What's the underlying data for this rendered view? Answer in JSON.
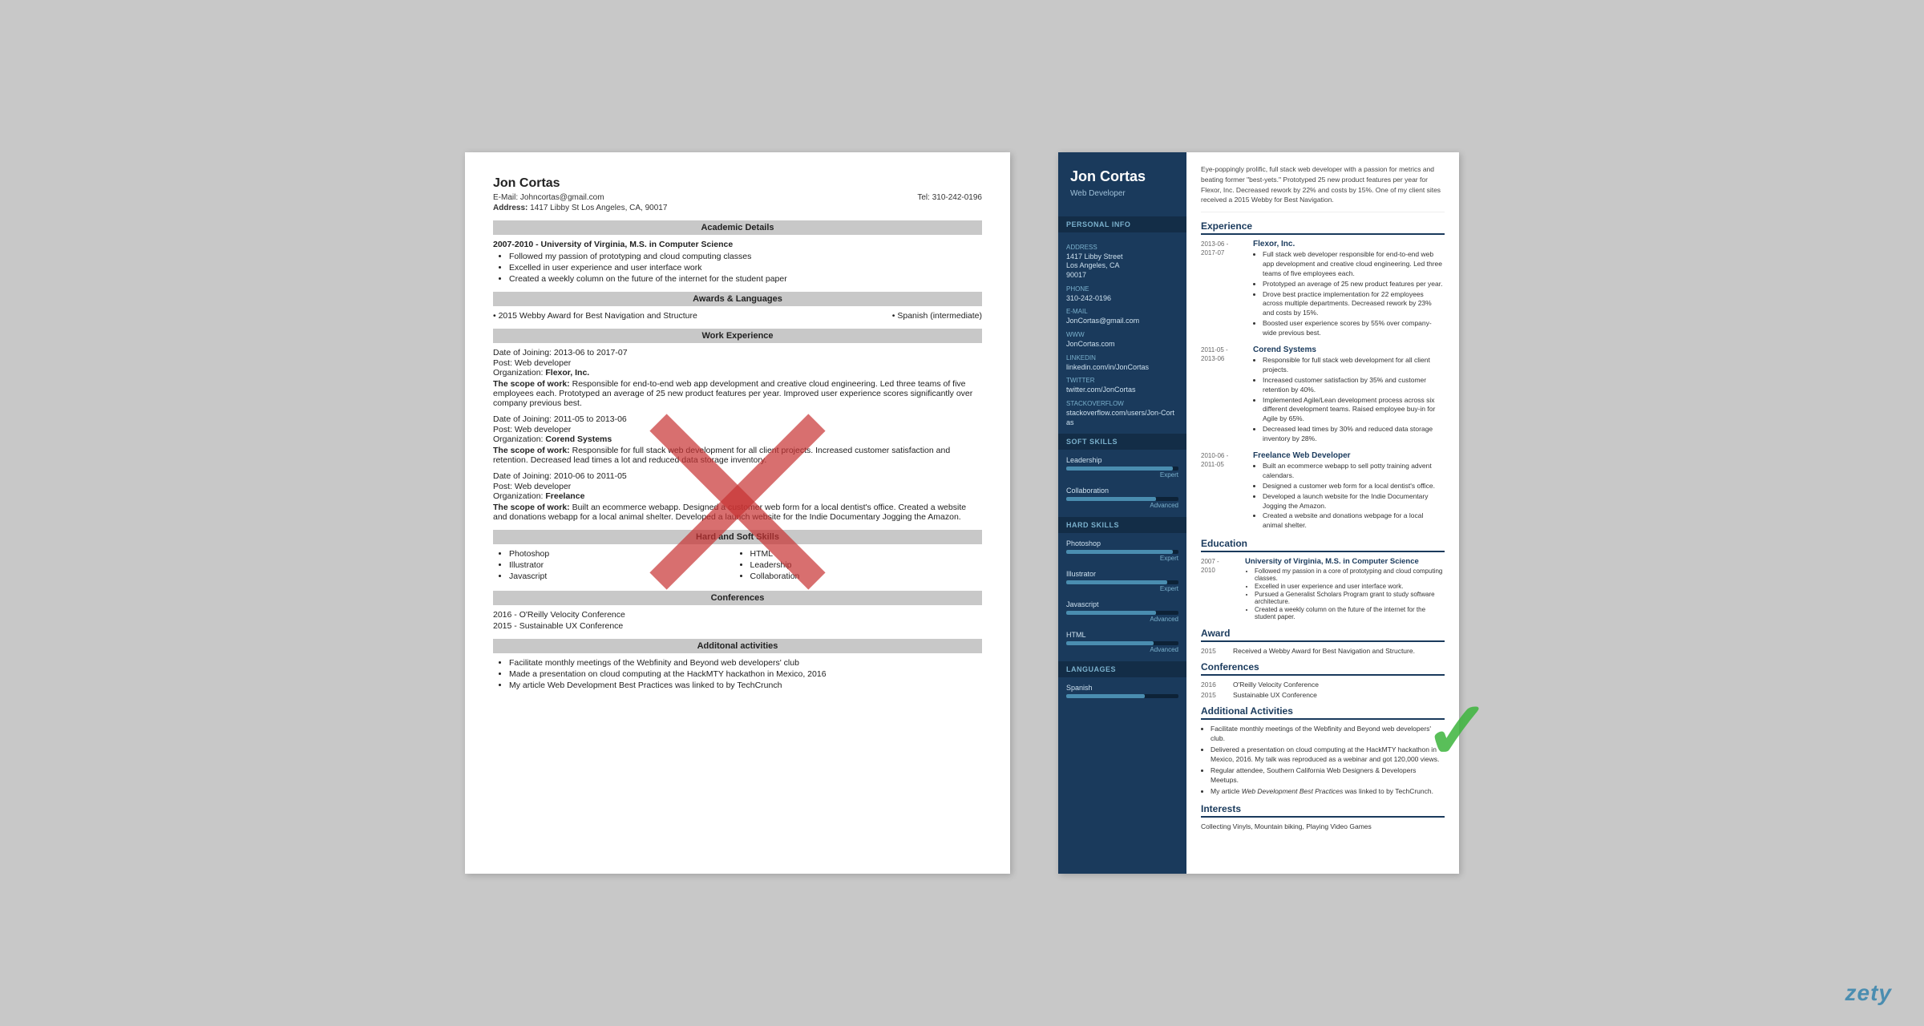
{
  "left_resume": {
    "name": "Jon Cortas",
    "email": "E-Mail: Johncortas@gmail.com",
    "tel": "Tel: 310-242-0196",
    "address_label": "Address:",
    "address": "1417 Libby St Los Angeles, CA, 90017",
    "sections": {
      "academic": "Academic Details",
      "awards": "Awards & Languages",
      "work": "Work Experience",
      "skills": "Hard and Soft Skills",
      "conferences": "Conferences",
      "activities": "Additonal activities"
    },
    "academic_items": [
      "2007-2010 - University of Virginia, M.S. in Computer Science",
      "Followed my passion of prototyping and cloud computing classes",
      "Excelled in user experience and user interface work",
      "Created a weekly column on the future of the internet for the student paper"
    ],
    "awards_items": [
      "2015 Webby Award for Best Navigation and Structure",
      "Spanish (intermediate)"
    ],
    "work_entries": [
      {
        "date": "Date of Joining: 2013-06 to 2017-07",
        "post": "Post: Web developer",
        "org": "Organization: Flexor, Inc.",
        "scope": "The scope of work: Responsible for end-to-end web app development and creative cloud engineering. Led three teams of five employees each. Prototyped an average of 25 new product features per year. Improved user experience scores significantly over company previous best."
      },
      {
        "date": "Date of Joining: 2011-05 to 2013-06",
        "post": "Post: Web developer",
        "org": "Organization: Corend Systems",
        "scope": "The scope of work: Responsible for full stack web development for all client projects. Increased customer satisfaction and retention. Decreased lead times a lot and reduced data storage inventory."
      },
      {
        "date": "Date of Joining: 2010-06 to 2011-05",
        "post": "Post: Web developer",
        "org": "Organization: Freelance",
        "scope": "The scope of work: Built an ecommerce webapp. Designed a customer web form for a local dentist's office. Created a website and donations webapp for a local animal shelter. Developed a launch website for the Indie Documentary Jogging the Amazon."
      }
    ],
    "skills_items": [
      "Photoshop",
      "Illustrator",
      "Javascript",
      "HTML",
      "Leadership",
      "Collaboration"
    ],
    "conferences_items": [
      "2016 - O'Reilly Velocity Conference",
      "2015 - Sustainable UX Conference"
    ],
    "activities_items": [
      "Facilitate monthly meetings of the Webfinity and Beyond web developers' club",
      "Made a presentation on cloud computing at the HackMTY hackathon in Mexico, 2016",
      "My article Web Development Best Practices was linked to by TechCrunch"
    ]
  },
  "right_resume": {
    "name": "Jon Cortas",
    "title": "Web Developer",
    "summary": "Eye-poppingly prolific, full stack web developer with a passion for metrics and beating former \"best-yets.\" Prototyped 25 new product features per year for Flexor, Inc. Decreased rework by 22% and costs by 15%. One of my client sites received a 2015 Webby for Best Navigation.",
    "sidebar": {
      "personal_info_title": "Personal Info",
      "address_label": "Address",
      "address_value": "1417 Libby Street\nLos Angeles, CA\n90017",
      "phone_label": "Phone",
      "phone_value": "310-242-0196",
      "email_label": "E-mail",
      "email_value": "JonCortas@gmail.com",
      "www_label": "WWW",
      "www_value": "JonCortas.com",
      "linkedin_label": "LinkedIn",
      "linkedin_value": "linkedin.com/in/JonCortas",
      "twitter_label": "Twitter",
      "twitter_value": "twitter.com/JonCortas",
      "stackoverflow_label": "StackOverflow",
      "stackoverflow_value": "stackoverflow.com/users/Jon-Cortas",
      "soft_skills_title": "Soft Skills",
      "soft_skills": [
        {
          "name": "Leadership",
          "level": 95,
          "label": "Expert"
        },
        {
          "name": "Collaboration",
          "level": 80,
          "label": "Advanced"
        }
      ],
      "hard_skills_title": "Hard Skills",
      "hard_skills": [
        {
          "name": "Photoshop",
          "level": 95,
          "label": "Expert"
        },
        {
          "name": "Illustrator",
          "level": 90,
          "label": "Expert"
        },
        {
          "name": "Javascript",
          "level": 80,
          "label": "Advanced"
        },
        {
          "name": "HTML",
          "level": 78,
          "label": "Advanced"
        }
      ],
      "languages_title": "Languages",
      "languages": [
        {
          "name": "Spanish",
          "level": 70
        }
      ]
    },
    "experience_title": "Experience",
    "experiences": [
      {
        "date": "2013-06 -\n2017-07",
        "company": "Flexor, Inc.",
        "bullets": [
          "Full stack web developer responsible for end-to-end web app development and creative cloud engineering. Led three teams of five employees each.",
          "Prototyped an average of 25 new product features per year.",
          "Drove best practice implementation for 22 employees across multiple departments. Decreased rework by 23% and costs by 15%.",
          "Boosted user experience scores by 55% over company-wide previous best."
        ]
      },
      {
        "date": "2011-05 -\n2013-06",
        "company": "Corend Systems",
        "bullets": [
          "Responsible for full stack web development for all client projects.",
          "Increased customer satisfaction by 35% and customer retention by 40%.",
          "Implemented Agile/Lean development process across six different development teams. Raised employee buy-in for Agile by 65%.",
          "Decreased lead times by 30% and reduced data storage inventory by 28%."
        ]
      },
      {
        "date": "2010-06 -\n2011-05",
        "company": "Freelance Web Developer",
        "bullets": [
          "Built an ecommerce webapp to sell potty training advent calendars.",
          "Designed a customer web form for a local dentist's office.",
          "Developed a launch website for the Indie Documentary Jogging the Amazon.",
          "Created a website and donations webpage for a local animal shelter."
        ]
      }
    ],
    "education_title": "Education",
    "education": [
      {
        "date": "2007 -\n2010",
        "title": "University of Virginia, M.S. in Computer Science",
        "bullets": [
          "Followed my passion in a core of prototyping and cloud computing classes.",
          "Excelled in user experience and user interface work.",
          "Pursued a Generalist Scholars Program grant to study software architecture.",
          "Created a weekly column on the future of the internet for the student paper."
        ]
      }
    ],
    "award_title": "Award",
    "awards": [
      {
        "year": "2015",
        "text": "Received a Webby Award for Best Navigation and Structure."
      }
    ],
    "conferences_title": "Conferences",
    "conferences": [
      {
        "year": "2016",
        "text": "O'Reilly Velocity Conference"
      },
      {
        "year": "2015",
        "text": "Sustainable UX Conference"
      }
    ],
    "activities_title": "Additional Activities",
    "activities": [
      "Facilitate monthly meetings of the Webfinity and Beyond web developers' club.",
      "Delivered a presentation on cloud computing at the HackMTY hackathon in Mexico, 2016. My talk was reproduced as a webinar and got 120,000 views.",
      "Regular attendee, Southern California Web Designers & Developers Meetups.",
      "My article Web Development Best Practices was linked to by TechCrunch."
    ],
    "interests_title": "Interests",
    "interests": "Collecting Vinyls, Mountain biking, Playing Video Games"
  },
  "watermark": "zety"
}
